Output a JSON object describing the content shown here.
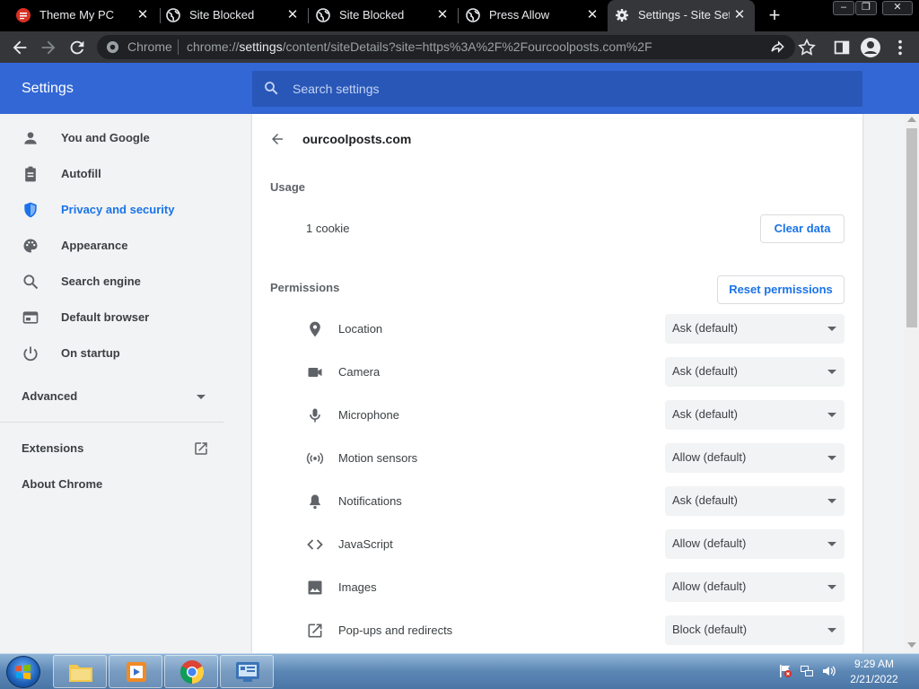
{
  "browser": {
    "tabs": [
      {
        "title": "Theme My PC",
        "favicon": "theme-favicon-icon"
      },
      {
        "title": "Site Blocked",
        "favicon": "globe-icon"
      },
      {
        "title": "Site Blocked",
        "favicon": "globe-icon"
      },
      {
        "title": "Press Allow",
        "favicon": "globe-icon"
      },
      {
        "title": "Settings - Site Setti",
        "favicon": "gear-icon"
      }
    ],
    "omnibox": {
      "scheme_label": "Chrome",
      "url_prefix": "chrome://",
      "url_host": "settings",
      "url_rest": "/content/siteDetails?site=https%3A%2F%2Fourcoolposts.com%2F"
    }
  },
  "settings": {
    "title": "Settings",
    "search_placeholder": "Search settings",
    "sidebar": {
      "items": [
        {
          "label": "You and Google",
          "icon": "person-icon"
        },
        {
          "label": "Autofill",
          "icon": "clipboard-icon"
        },
        {
          "label": "Privacy and security",
          "icon": "shield-icon",
          "selected": true
        },
        {
          "label": "Appearance",
          "icon": "palette-icon"
        },
        {
          "label": "Search engine",
          "icon": "search-icon"
        },
        {
          "label": "Default browser",
          "icon": "browser-icon"
        },
        {
          "label": "On startup",
          "icon": "power-icon"
        }
      ],
      "advanced": "Advanced",
      "extensions": "Extensions",
      "about": "About Chrome"
    },
    "site": {
      "host": "ourcoolposts.com",
      "usage_heading": "Usage",
      "cookie_count": "1 cookie",
      "clear_data": "Clear data",
      "permissions_heading": "Permissions",
      "reset_permissions": "Reset permissions",
      "permissions": [
        {
          "label": "Location",
          "value": "Ask (default)",
          "icon": "location-pin-icon"
        },
        {
          "label": "Camera",
          "value": "Ask (default)",
          "icon": "camera-icon"
        },
        {
          "label": "Microphone",
          "value": "Ask (default)",
          "icon": "microphone-icon"
        },
        {
          "label": "Motion sensors",
          "value": "Allow (default)",
          "icon": "motion-sensor-icon"
        },
        {
          "label": "Notifications",
          "value": "Ask (default)",
          "icon": "bell-icon"
        },
        {
          "label": "JavaScript",
          "value": "Allow (default)",
          "icon": "code-icon"
        },
        {
          "label": "Images",
          "value": "Allow (default)",
          "icon": "image-icon"
        },
        {
          "label": "Pop-ups and redirects",
          "value": "Block (default)",
          "icon": "open-in-new-icon"
        }
      ]
    }
  },
  "taskbar": {
    "time": "9:29 AM",
    "date": "2/21/2022"
  },
  "colors": {
    "header_blue": "#3367d6",
    "accent_blue": "#1a73e8",
    "tab_active": "#35363a"
  }
}
